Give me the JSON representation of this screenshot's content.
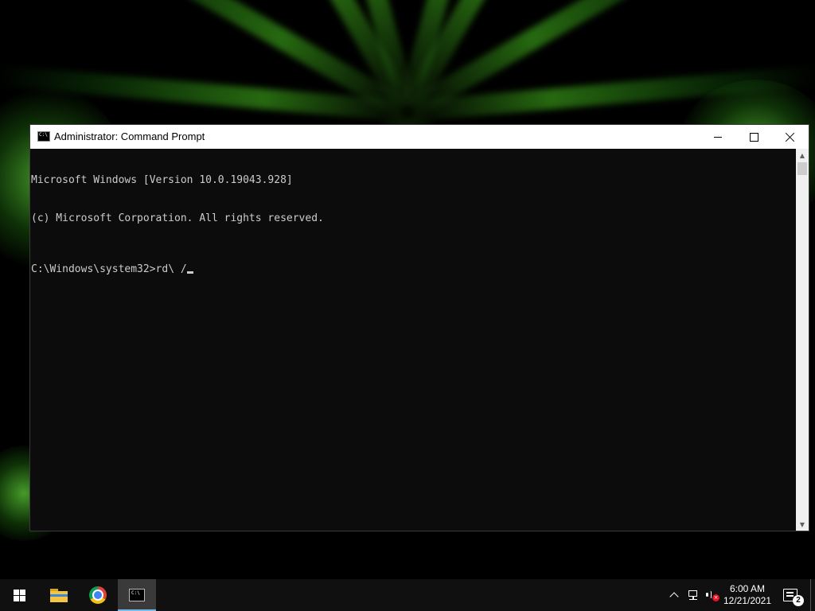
{
  "window": {
    "title": "Administrator: Command Prompt",
    "icon": "cmd-icon",
    "icon_text": "C:\\"
  },
  "console": {
    "lines": [
      "Microsoft Windows [Version 10.0.19043.928]",
      "(c) Microsoft Corporation. All rights reserved."
    ],
    "prompt": "C:\\Windows\\system32>",
    "input": "rd\\ /"
  },
  "taskbar": {
    "items": [
      {
        "name": "start",
        "icon": "windows-logo-icon"
      },
      {
        "name": "file-explorer",
        "icon": "folder-icon"
      },
      {
        "name": "chrome",
        "icon": "chrome-icon"
      },
      {
        "name": "command-prompt",
        "icon": "cmd-icon",
        "active": true
      }
    ],
    "tray": {
      "chevron_icon": "chevron-up-icon",
      "network_icon": "network-icon",
      "volume_icon": "volume-muted-icon",
      "notification_count": "2"
    },
    "clock": {
      "time": "6:00 AM",
      "date": "12/21/2021"
    }
  },
  "colors": {
    "console_bg": "#0c0c0c",
    "console_fg": "#cccccc",
    "accent": "#76b9ed",
    "wallpaper_green": "#46be1e"
  }
}
